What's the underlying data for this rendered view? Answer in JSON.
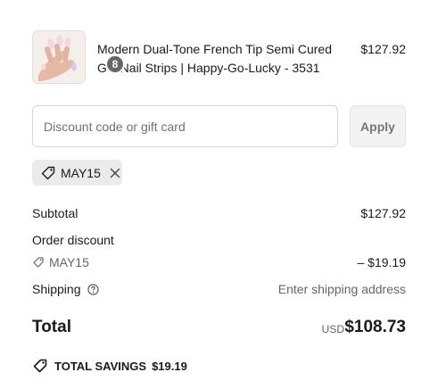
{
  "product": {
    "name": "Modern Dual-Tone French Tip Semi Cured Gel Nail Strips | Happy-Go-Lucky - 3531",
    "price": "$127.92",
    "quantity": "8",
    "image_icon": "nail-strips-photo"
  },
  "discount": {
    "placeholder": "Discount code or gift card",
    "value": "",
    "apply_label": "Apply",
    "applied_code": "MAY15",
    "remove_icon": "close-icon"
  },
  "summary": {
    "subtotal_label": "Subtotal",
    "subtotal_value": "$127.92",
    "order_discount_label": "Order discount",
    "discount_code": "MAY15",
    "discount_value": "– $19.19",
    "shipping_label": "Shipping",
    "shipping_value": "Enter shipping address",
    "total_label": "Total",
    "currency": "USD",
    "total_value": "$108.73"
  },
  "savings": {
    "label": "TOTAL SAVINGS",
    "amount": "$19.19"
  },
  "colors": {
    "badge": "#666666",
    "chip_bg": "#ebebeb",
    "muted_text": "#666666",
    "apply_bg": "#f3f3f3"
  }
}
